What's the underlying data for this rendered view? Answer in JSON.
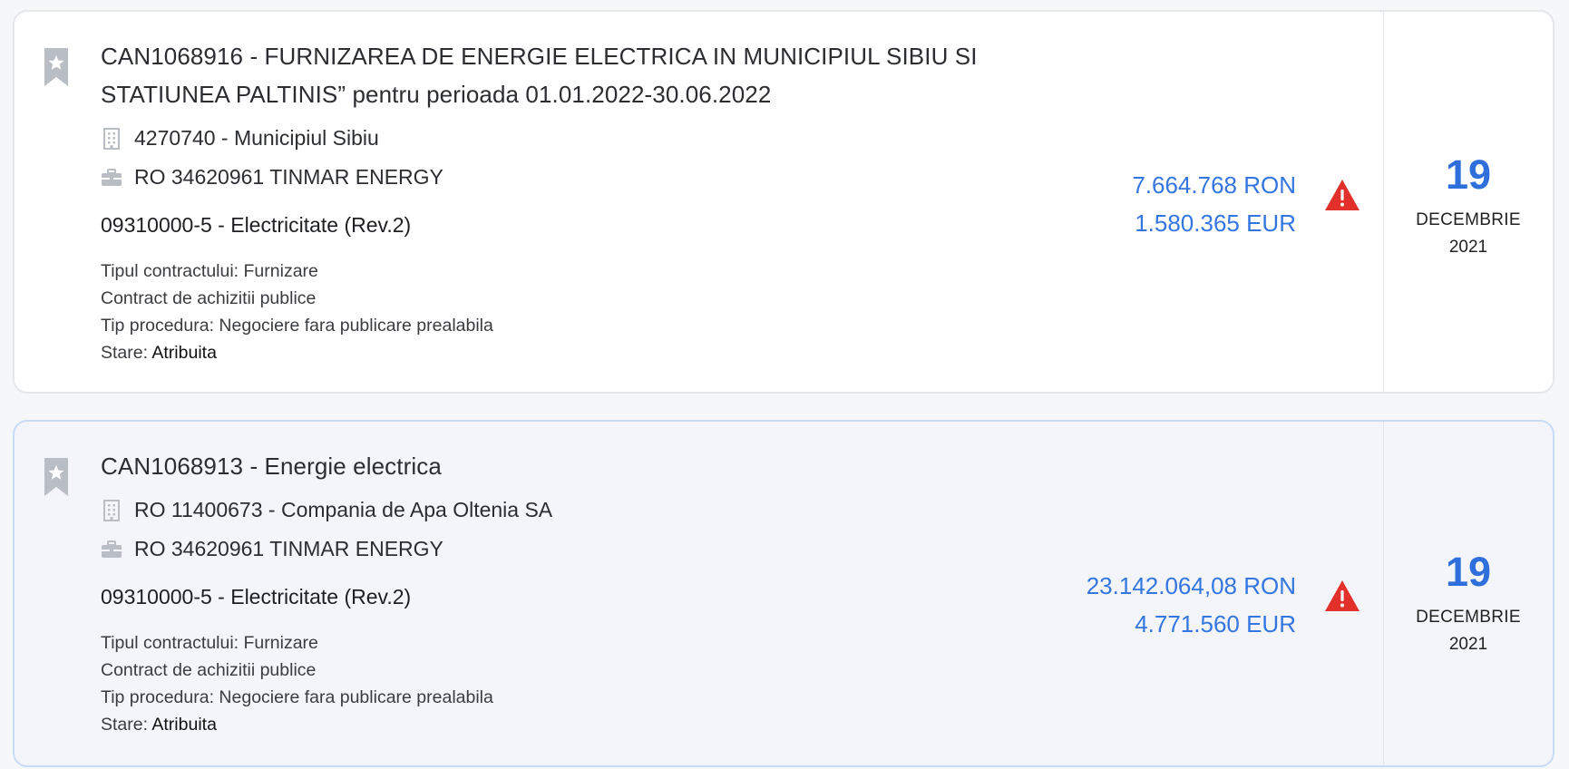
{
  "colors": {
    "accent_blue": "#3476e0",
    "day_blue": "#2f6fdc",
    "alert_red": "#e2312a",
    "icon_gray": "#b9bdc4",
    "card_border": "#e4e6ea",
    "card_highlight_bg": "#f3f5fa",
    "card_highlight_border": "#c8dcf7"
  },
  "cards": [
    {
      "bookmark_icon": "bookmark-star-icon",
      "title": "CAN1068916 - FURNIZAREA DE ENERGIE ELECTRICA IN MUNICIPIUL SIBIU SI STATIUNEA PALTINIS” pentru perioada 01.01.2022-30.06.2022",
      "authority_icon": "building-icon",
      "authority": "4270740 - Municipiul Sibiu",
      "supplier_icon": "briefcase-icon",
      "supplier": "RO 34620961 TINMAR ENERGY",
      "cpv": "09310000-5 - Electricitate (Rev.2)",
      "contract_type": "Tipul contractului: Furnizare",
      "contract_kind": "Contract de achizitii publice",
      "procedure": "Tip procedura: Negociere fara publicare prealabila",
      "status_label": "Stare:",
      "status_value": "Atribuita",
      "amount_ron": "7.664.768 RON",
      "amount_eur": "1.580.365 EUR",
      "alert_icon": "warning-triangle-icon",
      "date_day": "19",
      "date_month": "DECEMBRIE",
      "date_year": "2021"
    },
    {
      "bookmark_icon": "bookmark-star-icon",
      "title": "CAN1068913 - Energie electrica",
      "authority_icon": "building-icon",
      "authority": "RO 11400673 - Compania de Apa Oltenia SA",
      "supplier_icon": "briefcase-icon",
      "supplier": "RO 34620961 TINMAR ENERGY",
      "cpv": "09310000-5 - Electricitate (Rev.2)",
      "contract_type": "Tipul contractului: Furnizare",
      "contract_kind": "Contract de achizitii publice",
      "procedure": "Tip procedura: Negociere fara publicare prealabila",
      "status_label": "Stare:",
      "status_value": "Atribuita",
      "amount_ron": "23.142.064,08 RON",
      "amount_eur": "4.771.560 EUR",
      "alert_icon": "warning-triangle-icon",
      "date_day": "19",
      "date_month": "DECEMBRIE",
      "date_year": "2021"
    }
  ]
}
